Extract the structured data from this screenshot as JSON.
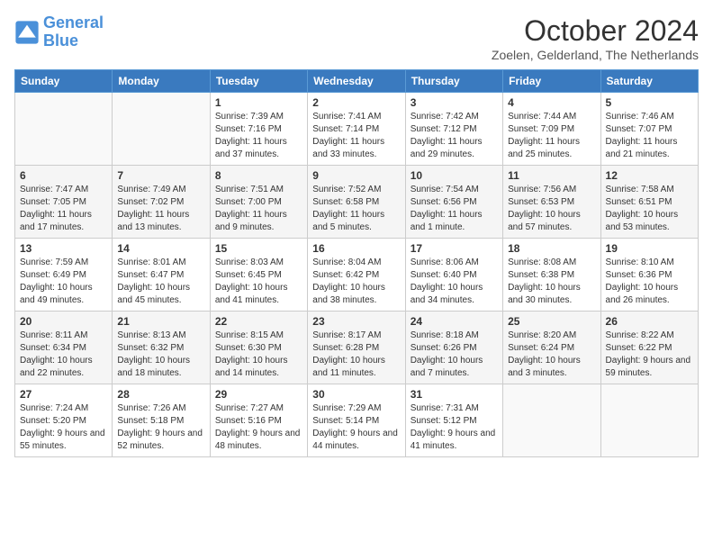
{
  "header": {
    "logo_line1": "General",
    "logo_line2": "Blue",
    "month": "October 2024",
    "location": "Zoelen, Gelderland, The Netherlands"
  },
  "days_of_week": [
    "Sunday",
    "Monday",
    "Tuesday",
    "Wednesday",
    "Thursday",
    "Friday",
    "Saturday"
  ],
  "weeks": [
    [
      {
        "day": "",
        "info": ""
      },
      {
        "day": "",
        "info": ""
      },
      {
        "day": "1",
        "info": "Sunrise: 7:39 AM\nSunset: 7:16 PM\nDaylight: 11 hours and 37 minutes."
      },
      {
        "day": "2",
        "info": "Sunrise: 7:41 AM\nSunset: 7:14 PM\nDaylight: 11 hours and 33 minutes."
      },
      {
        "day": "3",
        "info": "Sunrise: 7:42 AM\nSunset: 7:12 PM\nDaylight: 11 hours and 29 minutes."
      },
      {
        "day": "4",
        "info": "Sunrise: 7:44 AM\nSunset: 7:09 PM\nDaylight: 11 hours and 25 minutes."
      },
      {
        "day": "5",
        "info": "Sunrise: 7:46 AM\nSunset: 7:07 PM\nDaylight: 11 hours and 21 minutes."
      }
    ],
    [
      {
        "day": "6",
        "info": "Sunrise: 7:47 AM\nSunset: 7:05 PM\nDaylight: 11 hours and 17 minutes."
      },
      {
        "day": "7",
        "info": "Sunrise: 7:49 AM\nSunset: 7:02 PM\nDaylight: 11 hours and 13 minutes."
      },
      {
        "day": "8",
        "info": "Sunrise: 7:51 AM\nSunset: 7:00 PM\nDaylight: 11 hours and 9 minutes."
      },
      {
        "day": "9",
        "info": "Sunrise: 7:52 AM\nSunset: 6:58 PM\nDaylight: 11 hours and 5 minutes."
      },
      {
        "day": "10",
        "info": "Sunrise: 7:54 AM\nSunset: 6:56 PM\nDaylight: 11 hours and 1 minute."
      },
      {
        "day": "11",
        "info": "Sunrise: 7:56 AM\nSunset: 6:53 PM\nDaylight: 10 hours and 57 minutes."
      },
      {
        "day": "12",
        "info": "Sunrise: 7:58 AM\nSunset: 6:51 PM\nDaylight: 10 hours and 53 minutes."
      }
    ],
    [
      {
        "day": "13",
        "info": "Sunrise: 7:59 AM\nSunset: 6:49 PM\nDaylight: 10 hours and 49 minutes."
      },
      {
        "day": "14",
        "info": "Sunrise: 8:01 AM\nSunset: 6:47 PM\nDaylight: 10 hours and 45 minutes."
      },
      {
        "day": "15",
        "info": "Sunrise: 8:03 AM\nSunset: 6:45 PM\nDaylight: 10 hours and 41 minutes."
      },
      {
        "day": "16",
        "info": "Sunrise: 8:04 AM\nSunset: 6:42 PM\nDaylight: 10 hours and 38 minutes."
      },
      {
        "day": "17",
        "info": "Sunrise: 8:06 AM\nSunset: 6:40 PM\nDaylight: 10 hours and 34 minutes."
      },
      {
        "day": "18",
        "info": "Sunrise: 8:08 AM\nSunset: 6:38 PM\nDaylight: 10 hours and 30 minutes."
      },
      {
        "day": "19",
        "info": "Sunrise: 8:10 AM\nSunset: 6:36 PM\nDaylight: 10 hours and 26 minutes."
      }
    ],
    [
      {
        "day": "20",
        "info": "Sunrise: 8:11 AM\nSunset: 6:34 PM\nDaylight: 10 hours and 22 minutes."
      },
      {
        "day": "21",
        "info": "Sunrise: 8:13 AM\nSunset: 6:32 PM\nDaylight: 10 hours and 18 minutes."
      },
      {
        "day": "22",
        "info": "Sunrise: 8:15 AM\nSunset: 6:30 PM\nDaylight: 10 hours and 14 minutes."
      },
      {
        "day": "23",
        "info": "Sunrise: 8:17 AM\nSunset: 6:28 PM\nDaylight: 10 hours and 11 minutes."
      },
      {
        "day": "24",
        "info": "Sunrise: 8:18 AM\nSunset: 6:26 PM\nDaylight: 10 hours and 7 minutes."
      },
      {
        "day": "25",
        "info": "Sunrise: 8:20 AM\nSunset: 6:24 PM\nDaylight: 10 hours and 3 minutes."
      },
      {
        "day": "26",
        "info": "Sunrise: 8:22 AM\nSunset: 6:22 PM\nDaylight: 9 hours and 59 minutes."
      }
    ],
    [
      {
        "day": "27",
        "info": "Sunrise: 7:24 AM\nSunset: 5:20 PM\nDaylight: 9 hours and 55 minutes."
      },
      {
        "day": "28",
        "info": "Sunrise: 7:26 AM\nSunset: 5:18 PM\nDaylight: 9 hours and 52 minutes."
      },
      {
        "day": "29",
        "info": "Sunrise: 7:27 AM\nSunset: 5:16 PM\nDaylight: 9 hours and 48 minutes."
      },
      {
        "day": "30",
        "info": "Sunrise: 7:29 AM\nSunset: 5:14 PM\nDaylight: 9 hours and 44 minutes."
      },
      {
        "day": "31",
        "info": "Sunrise: 7:31 AM\nSunset: 5:12 PM\nDaylight: 9 hours and 41 minutes."
      },
      {
        "day": "",
        "info": ""
      },
      {
        "day": "",
        "info": ""
      }
    ]
  ]
}
